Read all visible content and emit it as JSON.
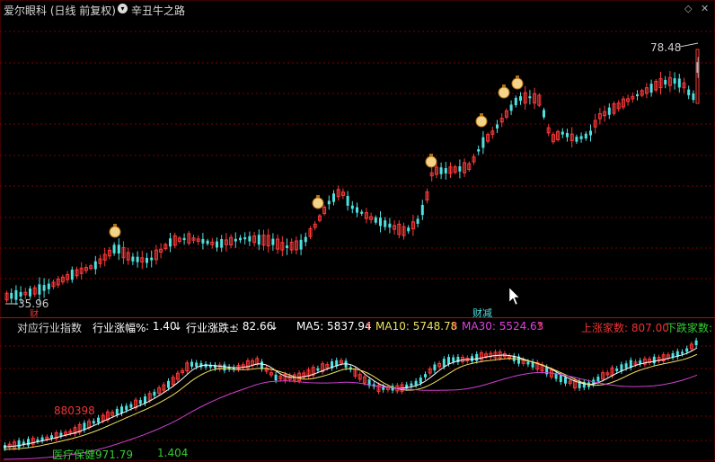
{
  "header": {
    "title": "爱尔眼科 (日线 前复权)",
    "formula": "辛丑牛之路",
    "menu_glyph": "◇",
    "close_glyph": "✕"
  },
  "main_chart": {
    "high_label": "78.48",
    "low_label": "35.96",
    "finance_label": "财",
    "finance_tag": "财减",
    "colors": {
      "up": "#ff3a3a",
      "down": "#4fe0e0",
      "grid": "#7a0000"
    }
  },
  "indicator_bar": {
    "title": "对应行业指数",
    "industry_pct_label": "行业涨幅%",
    "industry_pct_value": ": 1.40",
    "industry_chg_label": "行业涨跌±",
    "industry_chg_value": ": 82.66",
    "ma5": "MA5: 5837.94",
    "ma10": "MA10: 5748.78",
    "ma30": "MA30: 5524.63",
    "up_count": "上涨家数: 807.00",
    "down_count": "下跌家数:"
  },
  "sub_chart": {
    "left_value": "880398",
    "index_name": "医疗保健971.79",
    "ratio": "1.404"
  }
}
